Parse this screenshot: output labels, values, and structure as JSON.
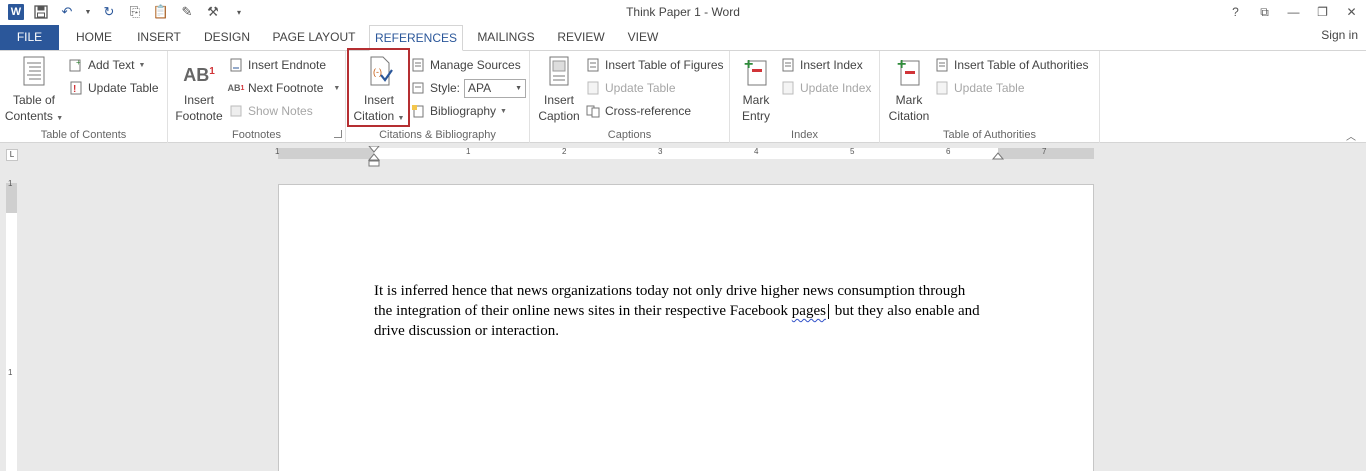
{
  "window": {
    "title": "Think Paper 1 - Word",
    "controls": [
      "?",
      "⧉",
      "—",
      "❐",
      "✕"
    ]
  },
  "tabs": {
    "file": "FILE",
    "items": [
      "HOME",
      "INSERT",
      "DESIGN",
      "PAGE LAYOUT",
      "REFERENCES",
      "MAILINGS",
      "REVIEW",
      "VIEW"
    ],
    "active": "REFERENCES",
    "signin": "Sign in"
  },
  "ribbon": {
    "toc": {
      "label": "Table of Contents",
      "big_line1": "Table of",
      "big_line2": "Contents",
      "add_text": "Add Text",
      "update_table": "Update Table"
    },
    "footnotes": {
      "label": "Footnotes",
      "insert_line1": "Insert",
      "insert_line2": "Footnote",
      "insert_endnote": "Insert Endnote",
      "next_footnote": "Next Footnote",
      "show_notes": "Show Notes"
    },
    "citations": {
      "label": "Citations & Bibliography",
      "insert_line1": "Insert",
      "insert_line2": "Citation",
      "manage_sources": "Manage Sources",
      "style_label": "Style:",
      "style_value": "APA",
      "bibliography": "Bibliography"
    },
    "captions": {
      "label": "Captions",
      "insert_line1": "Insert",
      "insert_line2": "Caption",
      "insert_tof": "Insert Table of Figures",
      "update_table": "Update Table",
      "cross_reference": "Cross-reference"
    },
    "index": {
      "label": "Index",
      "mark_line1": "Mark",
      "mark_line2": "Entry",
      "insert_index": "Insert Index",
      "update_index": "Update Index"
    },
    "toa": {
      "label": "Table of Authorities",
      "mark_line1": "Mark",
      "mark_line2": "Citation",
      "insert_toa": "Insert Table of Authorities",
      "update_table": "Update Table"
    }
  },
  "ruler": {
    "numbers": [
      "1",
      "1",
      "2",
      "3",
      "4",
      "5",
      "6",
      "7"
    ],
    "vnumbers": [
      "1",
      "1"
    ]
  },
  "document": {
    "text_before": "It is inferred hence that news organizations today not only drive higher news consumption through the integration of their online news sites in their respective Facebook ",
    "flagged_word": "pages",
    "text_after": " but they also enable and drive discussion or interaction."
  },
  "colors": {
    "accent": "#2b579a",
    "highlight_box": "#b52e31"
  }
}
